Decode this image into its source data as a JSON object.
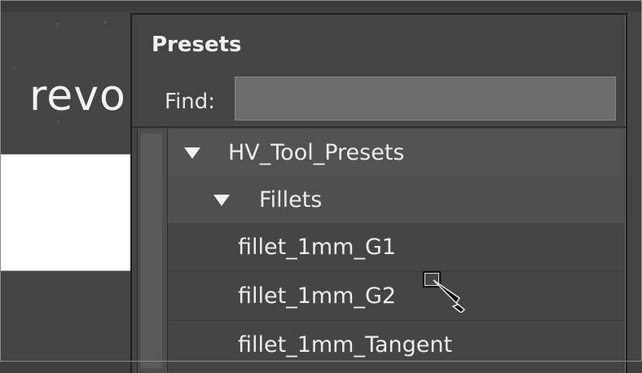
{
  "background_app": {
    "label": "revo"
  },
  "presets_panel": {
    "title": "Presets",
    "find_label": "Find:",
    "find_value": "",
    "tree": {
      "root": {
        "label": "HV_Tool_Presets",
        "expanded": true
      },
      "folder": {
        "label": "Fillets",
        "expanded": true
      },
      "items": [
        {
          "label": "fillet_1mm_G1"
        },
        {
          "label": "fillet_1mm_G2"
        },
        {
          "label": "fillet_1mm_Tangent"
        }
      ]
    }
  },
  "cursor": {
    "icon": "drag-select-cursor-icon"
  }
}
